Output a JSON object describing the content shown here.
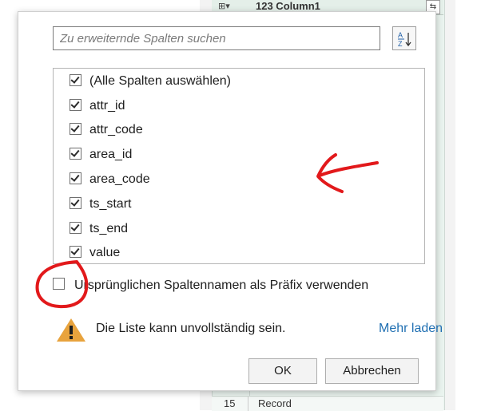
{
  "background": {
    "column_header": {
      "type_icon": "⊞▾",
      "name": "123 Column1"
    },
    "footer_row": {
      "row_number": "15",
      "value": "Record"
    }
  },
  "dialog": {
    "search": {
      "placeholder": "Zu erweiternde Spalten suchen",
      "value": ""
    },
    "sort_button": {
      "icon": "sort-az-icon"
    },
    "columns": [
      {
        "label": "(Alle Spalten auswählen)",
        "checked": true
      },
      {
        "label": "attr_id",
        "checked": true
      },
      {
        "label": "attr_code",
        "checked": true
      },
      {
        "label": "area_id",
        "checked": true
      },
      {
        "label": "area_code",
        "checked": true
      },
      {
        "label": "ts_start",
        "checked": true
      },
      {
        "label": "ts_end",
        "checked": true
      },
      {
        "label": "value",
        "checked": true
      }
    ],
    "prefix_option": {
      "label": "Ursprünglichen Spaltennamen als Präfix verwenden",
      "checked": false
    },
    "warning": {
      "icon": "warning-icon",
      "text": "Die Liste kann unvollständig sein.",
      "link": "Mehr laden"
    },
    "buttons": {
      "ok": "OK",
      "cancel": "Abbrechen"
    }
  },
  "colors": {
    "link": "#1f6fb2",
    "warning_icon": "#e8a33d",
    "annotation": "#e2191b"
  }
}
